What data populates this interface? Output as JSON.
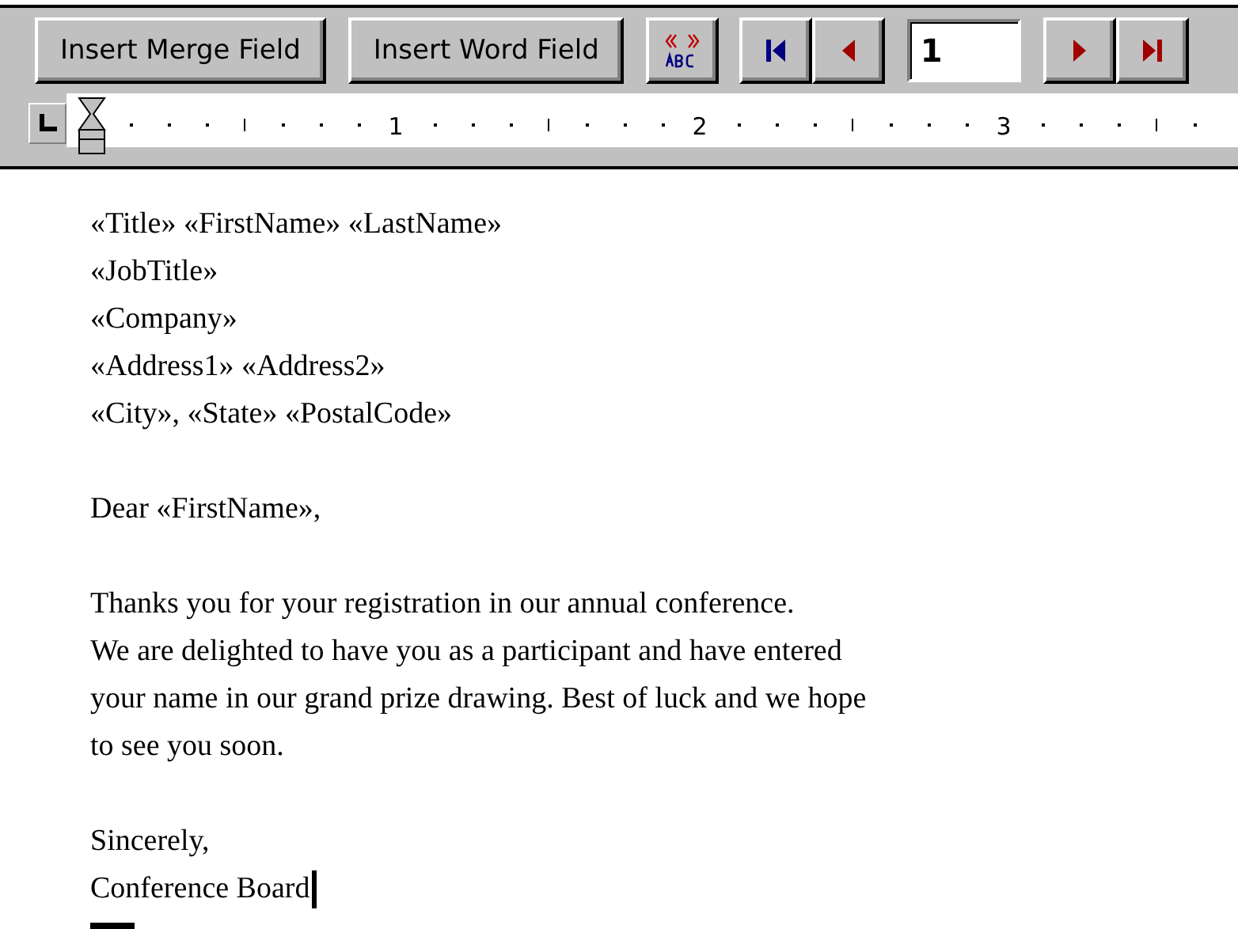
{
  "toolbar": {
    "buttons": [
      {
        "kind": "text",
        "label": "Insert Merge Field"
      },
      {
        "kind": "text",
        "label": "Insert Word Field"
      },
      {
        "kind": "abc"
      },
      {
        "kind": "first"
      },
      {
        "kind": "prev"
      },
      {
        "kind": "record",
        "value": "1"
      },
      {
        "kind": "next"
      },
      {
        "kind": "last"
      }
    ]
  },
  "ruler": {
    "labels": [
      "1",
      "2",
      "3"
    ]
  },
  "document": {
    "paragraphs": [
      {
        "lines": [
          "«Title» «FirstName» «LastName»",
          "«JobTitle»",
          "«Company»",
          "«Address1» «Address2»",
          "«City», «State» «PostalCode»"
        ]
      },
      {
        "lines": [
          "Dear «FirstName»,"
        ]
      },
      {
        "lines": [
          "Thanks you for your registration in our annual conference.",
          "We are delighted to have you as a participant and have entered",
          "your name in our grand prize drawing.  Best of luck and we hope",
          "to see you soon."
        ]
      },
      {
        "lines": [
          "Sincerely,",
          "Conference Board"
        ]
      }
    ],
    "cursor": true
  }
}
